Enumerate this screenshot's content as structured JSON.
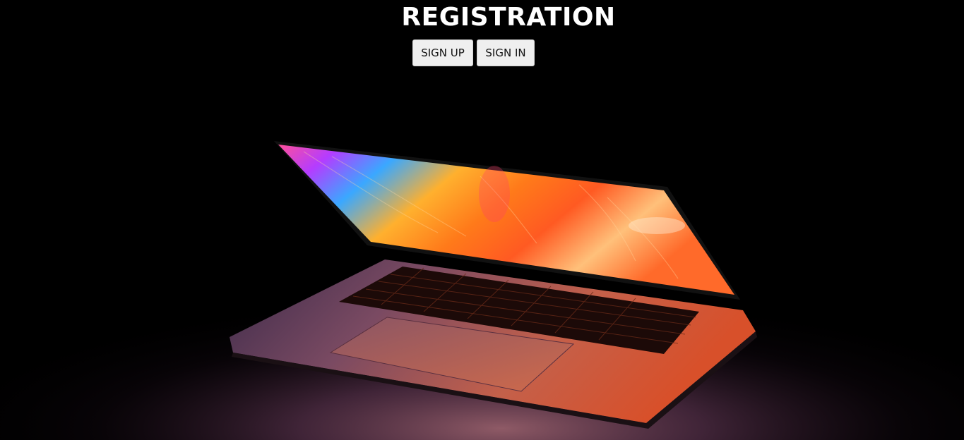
{
  "header": {
    "title": "REGISTRATION"
  },
  "buttons": {
    "sign_up": "SIGN UP",
    "sign_in": "SIGN IN"
  },
  "background": {
    "image": "laptop-glowing-screen",
    "color": "#000000"
  }
}
